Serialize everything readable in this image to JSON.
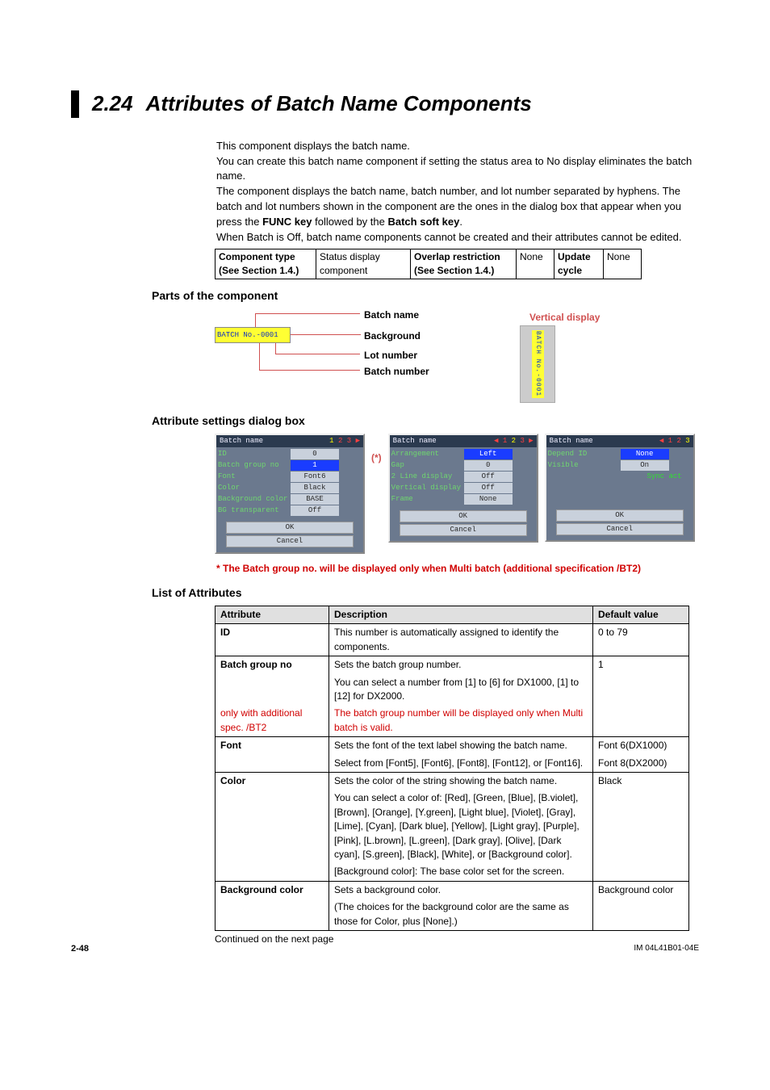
{
  "section": {
    "number": "2.24",
    "title": "Attributes of Batch Name Components"
  },
  "intro": {
    "l1": "This component displays the batch name.",
    "l2": "You can create this batch name component if setting the status area to No display eliminates the batch name.",
    "l3": "The component displays the batch name, batch number, and lot number separated by hyphens. The batch and lot numbers shown in the component are the ones in the dialog box that appear when you press the ",
    "funckey": "FUNC key",
    "l3b": " followed by the ",
    "batchkey": "Batch soft key",
    "period": ".",
    "l4": "When Batch is Off, batch name components cannot be created and their attributes cannot be edited."
  },
  "meta": {
    "compTypeLabel": "Component type (See Section 1.4.)",
    "compTypeVal": "Status display component",
    "overlapLabel": "Overlap restriction (See Section 1.4.)",
    "overlapVal": "None",
    "updateLabel": "Update cycle",
    "updateVal": "None"
  },
  "parts": {
    "heading": "Parts of the component",
    "batch_sample": "BATCH No.-0001",
    "c_batchname": "Batch name",
    "c_background": "Background",
    "c_lotnumber": "Lot number",
    "c_batchnumber": "Batch number",
    "verticalLabel": "Vertical display",
    "verticalText": "BATCH No.-0001"
  },
  "dialog": {
    "heading": "Attribute settings dialog box",
    "p1": {
      "title": "Batch name",
      "nav_left": "",
      "nav": "1 2 3 ▶",
      "rows": [
        {
          "lab": "ID",
          "val": "0",
          "sel": false
        },
        {
          "lab": "Batch group no",
          "val": "1",
          "sel": true
        },
        {
          "lab": "Font",
          "val": "Font6",
          "sel": false
        },
        {
          "lab": "Color",
          "val": "Black",
          "sel": false
        },
        {
          "lab": "Background color",
          "val": "BASE",
          "sel": false
        },
        {
          "lab": "BG transparent",
          "val": "Off",
          "sel": false
        }
      ],
      "ok": "OK",
      "cancel": "Cancel"
    },
    "asterisk": "(*)",
    "p2": {
      "title": "Batch name",
      "nav": "◀ 1 2 3 ▶",
      "rows": [
        {
          "lab": "Arrangement",
          "val": "Left",
          "sel": true
        },
        {
          "lab": "Gap",
          "val": "0",
          "sel": false
        },
        {
          "lab": "2 Line display",
          "val": "Off",
          "sel": false
        },
        {
          "lab": "Vertical display",
          "val": "Off",
          "sel": false
        },
        {
          "lab": "Frame",
          "val": "None",
          "sel": false
        }
      ],
      "ok": "OK",
      "cancel": "Cancel"
    },
    "p3": {
      "title": "Batch name",
      "nav": "◀ 1 2 3",
      "rows": [
        {
          "lab": "Depend ID",
          "val": "None",
          "sel": true
        },
        {
          "lab": "Visible",
          "val": "On",
          "sel": false
        }
      ],
      "sync": "Sync act",
      "ok": "OK",
      "cancel": "Cancel"
    }
  },
  "note": "* The Batch group no. will be displayed only when Multi batch (additional specification /BT2)",
  "listHeading": "List of Attributes",
  "th": {
    "attr": "Attribute",
    "desc": "Description",
    "dflt": "Default value"
  },
  "rows": {
    "id": {
      "name": "ID",
      "d1": "This number is automatically assigned to identify the components.",
      "dflt": "0 to 79"
    },
    "bg": {
      "name": "Batch group no",
      "d1": "Sets the batch group number.",
      "d2": "You can select a number from [1] to [6] for DX1000, [1] to [12] for DX2000.",
      "note_name": "only with additional spec. /BT2",
      "d3": "The batch group number will be displayed only when Multi batch is valid.",
      "dflt": "1"
    },
    "font": {
      "name": "Font",
      "d1": "Sets the font of the text label showing the batch name.",
      "d2": "Select from [Font5], [Font6], [Font8], [Font12], or [Font16].",
      "dflt1": "Font 6(DX1000)",
      "dflt2": "Font 8(DX2000)"
    },
    "color": {
      "name": "Color",
      "d1": "Sets the color of the string showing the batch name.",
      "d2": "You can select a color of: [Red], [Green, [Blue], [B.violet], [Brown], [Orange], [Y.green], [Light blue], [Violet], [Gray], [Lime], [Cyan], [Dark blue], [Yellow], [Light gray], [Purple], [Pink], [L.brown], [L.green], [Dark gray], [Olive], [Dark cyan], [S.green], [Black], [White], or [Background color].",
      "d3": "[Background color]: The base color set for the screen.",
      "dflt": "Black"
    },
    "bgc": {
      "name": "Background color",
      "d1": "Sets a background color.",
      "d2": "(The choices for the background color are the same as those for Color, plus [None].)",
      "dflt": "Background color"
    }
  },
  "continued": "Continued on the next page",
  "footer": {
    "page": "2-48",
    "doc": "IM 04L41B01-04E"
  }
}
